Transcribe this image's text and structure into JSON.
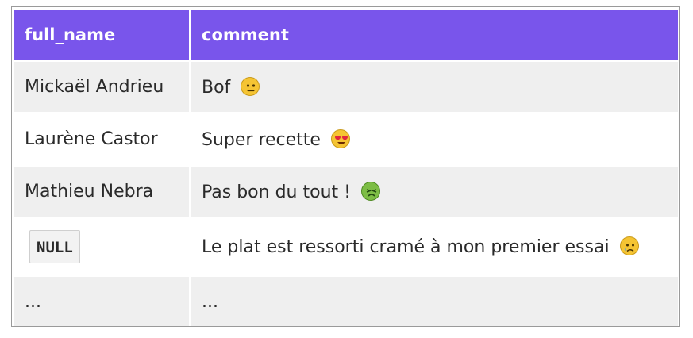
{
  "table": {
    "headers": [
      "full_name",
      "comment"
    ],
    "rows": [
      {
        "full_name": "Mickaël Andrieu",
        "comment": "Bof",
        "emoji": "neutral-face-icon"
      },
      {
        "full_name": "Laurène Castor",
        "comment": "Super recette",
        "emoji": "heart-eyes-icon"
      },
      {
        "full_name": "Mathieu Nebra",
        "comment": "Pas bon du tout !",
        "emoji": "nauseated-face-icon"
      },
      {
        "full_name": "NULL",
        "comment": "Le plat est ressorti cramé à mon premier essai",
        "emoji": "sad-tear-face-icon"
      },
      {
        "full_name": "...",
        "comment": "..."
      }
    ]
  },
  "colors": {
    "header_bg": "#7955eb",
    "header_text": "#ffffff",
    "row_alt_bg": "#efefef"
  }
}
